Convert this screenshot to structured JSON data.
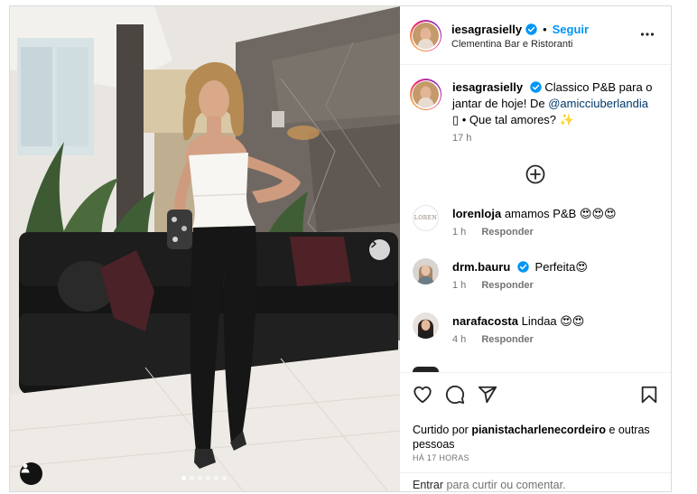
{
  "post": {
    "username": "iesagrasielly",
    "follow_label": "Seguir",
    "separator": "•",
    "location": "Clementina Bar e Ristoranti",
    "caption": {
      "username": "iesagrasielly",
      "text_before": "Classico P&B para o jantar de hoje! De ",
      "mention": "@amicciuberlandia",
      "text_after": " ▯ • Que tal amores? ✨",
      "time": "17 h"
    },
    "carousel": {
      "count": 6,
      "active_index": 0
    }
  },
  "comments": [
    {
      "username": "lorenloja",
      "text": "amamos P&B 😍😍😍",
      "time": "1 h",
      "reply": "Responder",
      "avatar_text": "LOREN",
      "verified": false
    },
    {
      "username": "drm.bauru",
      "text": "Perfeita😍",
      "time": "1 h",
      "reply": "Responder",
      "verified": true
    },
    {
      "username": "narafacosta",
      "text": "Lindaa 😍😍",
      "time": "4 h",
      "reply": "Responder",
      "verified": false
    }
  ],
  "engagement": {
    "liked_prefix": "Curtido por",
    "liked_user": "pianistacharlenecordeiro",
    "liked_suffix": "e outras pessoas",
    "time_ago": "HÁ 17 HORAS"
  },
  "login_bar": {
    "enter_label": "Entrar",
    "rest_label": "para curtir ou comentar."
  },
  "icons": {
    "verified": "verified-badge-icon",
    "more": "more-options-icon",
    "add": "add-circle-icon",
    "like": "heart-icon",
    "comment": "comment-icon",
    "share": "send-icon",
    "save": "bookmark-icon",
    "next": "chevron-right-icon",
    "user_tags": "user-tag-icon"
  },
  "colors": {
    "accent": "#0095f6",
    "mention": "#00376b",
    "muted": "#737373",
    "border": "#dbdbdb"
  }
}
